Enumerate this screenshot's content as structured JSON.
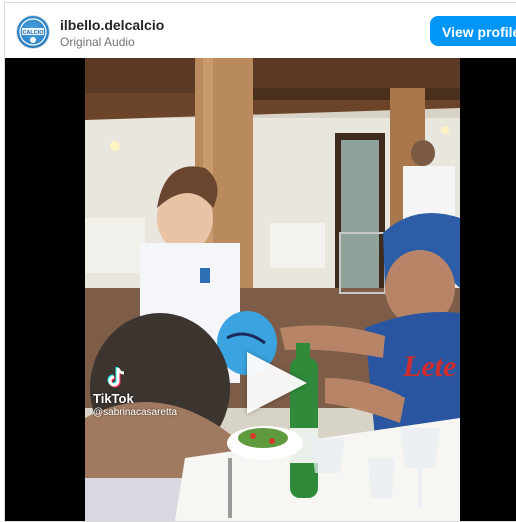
{
  "header": {
    "username": "ilbello.delcalcio",
    "audio_label": "Original Audio",
    "view_profile_label": "View profile",
    "avatar_text": "CALCIO"
  },
  "media": {
    "watermark_brand": "TikTok",
    "watermark_handle": "@sabrinacasaretta",
    "shirt_text": "Lete",
    "play_button": "play-icon"
  },
  "colors": {
    "accent": "#0095f6",
    "username": "#262626",
    "subtitle": "#737373"
  }
}
